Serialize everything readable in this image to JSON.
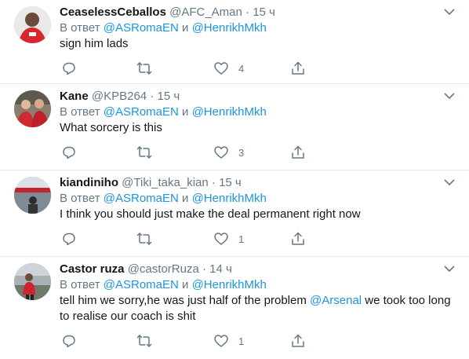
{
  "tweets": [
    {
      "name": "CeaselessCeballos",
      "handle": "@AFC_Aman",
      "dot": "·",
      "time": "15 ч",
      "reply_prefix": "В ответ",
      "reply_user1": "@ASRomaEN",
      "reply_and": "и",
      "reply_user2": "@HenrikhMkh",
      "text": "sign him lads",
      "likes": "4",
      "avatar_icon": "profile-arsenal-fan-avatar"
    },
    {
      "name": "Kane",
      "handle": "@KPB264",
      "dot": "·",
      "time": "15 ч",
      "reply_prefix": "В ответ",
      "reply_user1": "@ASRomaEN",
      "reply_and": "и",
      "reply_user2": "@HenrikhMkh",
      "text": "What sorcery is this",
      "likes": "3",
      "avatar_icon": "profile-two-fans-avatar"
    },
    {
      "name": "kiandiniho",
      "handle": "@Tiki_taka_kian",
      "dot": "·",
      "time": "15 ч",
      "reply_prefix": "В ответ",
      "reply_user1": "@ASRomaEN",
      "reply_and": "и",
      "reply_user2": "@HenrikhMkh",
      "text": "I think you should just make the deal permanent right now",
      "likes": "1",
      "avatar_icon": "profile-stadium-avatar"
    },
    {
      "name": "Castor ruza",
      "handle": "@castorRuza",
      "dot": "·",
      "time": "14 ч",
      "reply_prefix": "В ответ",
      "reply_user1": "@ASRomaEN",
      "reply_and": "и",
      "reply_user2": "@HenrikhMkh",
      "text_line1_part1": "tell him we sorry,he was just half of the problem",
      "text_line1_mention": "@Arsenal",
      "text_line1_part2": "we took too long",
      "text_line2": "to realise our coach is shit",
      "likes": "1",
      "avatar_icon": "profile-stadium-player-avatar"
    }
  ],
  "colors": {
    "link": "#1b95e0",
    "muted": "#657786",
    "text": "#14171a",
    "divider": "#e6ecf0"
  }
}
